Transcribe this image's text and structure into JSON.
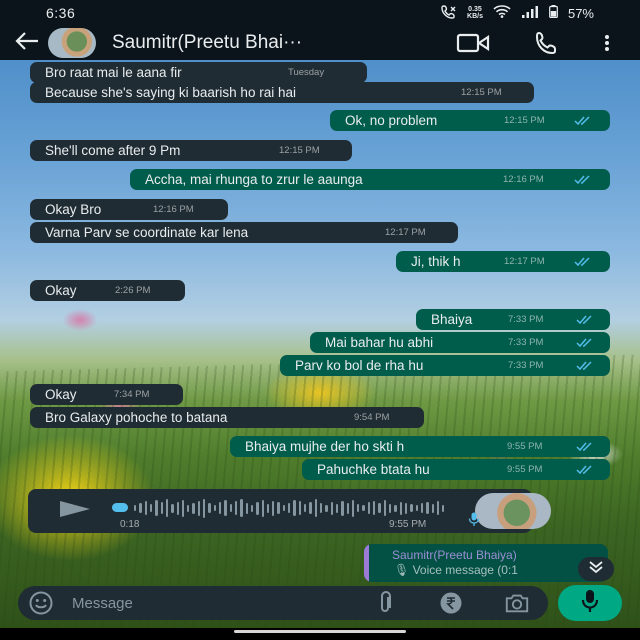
{
  "status_bar": {
    "time": "6:36",
    "net_speed_value": "0.35",
    "net_speed_unit": "KB/s",
    "battery": "57%"
  },
  "header": {
    "contact_name": "Saumitr(Preetu Bhai···",
    "icons": [
      "back-arrow-icon",
      "video-call-icon",
      "voice-call-icon",
      "more-options-icon"
    ]
  },
  "messages": [
    {
      "dir": "in",
      "text": "Bro raat mai le aana fir",
      "time": "Tuesday"
    },
    {
      "dir": "in",
      "text": "Because she's saying ki baarish ho rai hai",
      "time": "12:15 PM"
    },
    {
      "dir": "out",
      "text": "Ok, no problem",
      "time": "12:15 PM"
    },
    {
      "dir": "in",
      "text": "She'll come after 9 Pm",
      "time": "12:15 PM"
    },
    {
      "dir": "out",
      "text": "Accha, mai rhunga to zrur le aaunga",
      "time": "12:16 PM"
    },
    {
      "dir": "in",
      "text": "Okay Bro",
      "time": "12:16 PM"
    },
    {
      "dir": "in",
      "text": "Varna Parv se coordinate kar lena",
      "time": "12:17 PM"
    },
    {
      "dir": "out",
      "text": "Ji, thik h",
      "time": "12:17 PM"
    },
    {
      "dir": "in",
      "text": "Okay",
      "time": "2:26 PM"
    },
    {
      "dir": "out",
      "text": "Bhaiya",
      "time": "7:33 PM"
    },
    {
      "dir": "out",
      "text": "Mai bahar hu abhi",
      "time": "7:33 PM"
    },
    {
      "dir": "out",
      "text": "Parv ko bol de rha hu",
      "time": "7:33 PM"
    },
    {
      "dir": "in",
      "text": "Okay",
      "time": "7:34 PM"
    },
    {
      "dir": "in",
      "text": "Bro Galaxy pohoche to batana",
      "time": "9:54 PM"
    },
    {
      "dir": "out",
      "text": "Bhaiya mujhe der ho skti h",
      "time": "9:55 PM"
    },
    {
      "dir": "out",
      "text": "Pahuchke btata hu",
      "time": "9:55 PM"
    }
  ],
  "voice_note": {
    "duration": "0:18",
    "time": "9:55 PM",
    "progress": 0.0
  },
  "reply_preview": {
    "name": "Saumitr(Preetu Bhaiya)",
    "text": "Voice message (0:1"
  },
  "composer": {
    "placeholder": "Message"
  },
  "colors": {
    "incoming_bubble": "#202c33",
    "outgoing_bubble": "#005c4b",
    "accent": "#00a884",
    "read_ticks": "#53bdeb"
  }
}
